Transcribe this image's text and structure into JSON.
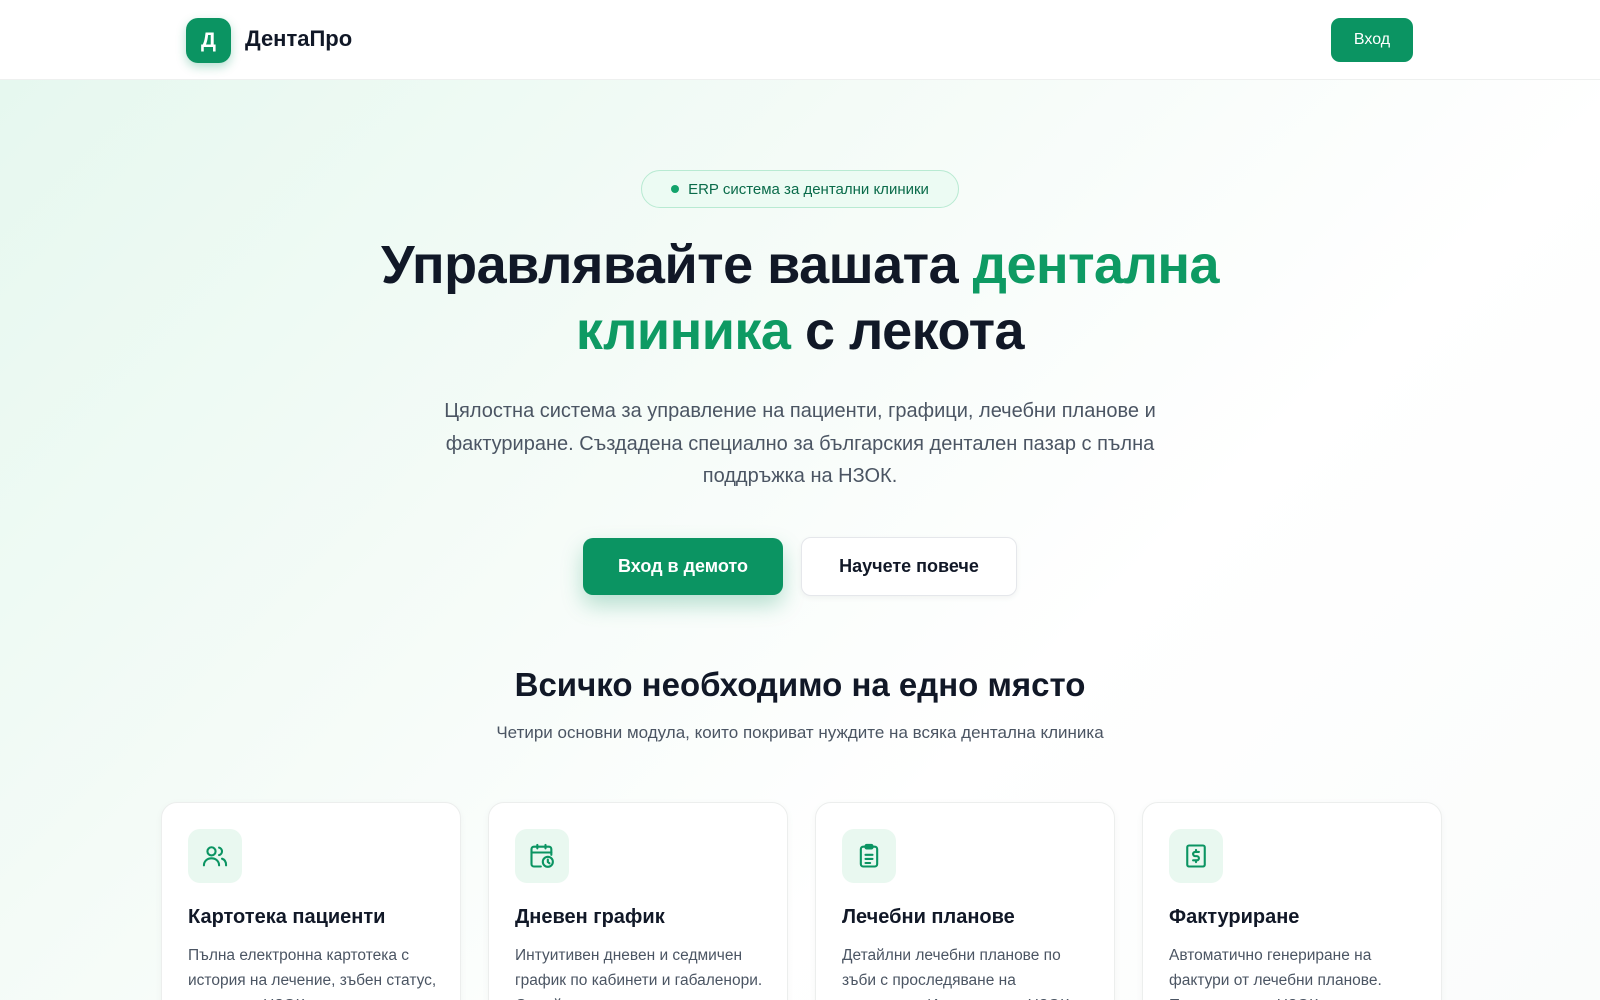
{
  "header": {
    "logo_letter": "Д",
    "brand": "ДентаПро",
    "login_label": "Вход"
  },
  "hero": {
    "badge": "ERP система за дентални клиники",
    "title_part1": "Управлявайте вашата ",
    "title_highlight": "дентална клиника",
    "title_part2": " с лекота",
    "subtitle": "Цялостна система за управление на пациенти, графици, лечебни планове и фактуриране. Създадена специално за българския дентален пазар с пълна поддръжка на НЗОК.",
    "primary_cta": "Вход в демото",
    "secondary_cta": "Научете повече"
  },
  "features": {
    "title": "Всичко необходимо на едно място",
    "subtitle": "Четири основни модула, които покриват нуждите на всяка дентална клиника",
    "cards": [
      {
        "icon": "users-icon",
        "title": "Картотека пациенти",
        "description": "Пълна електронна картотека с история на лечение, зъбен статус, алергии и НЗОК данни."
      },
      {
        "icon": "calendar-clock-icon",
        "title": "Дневен график",
        "description": "Интуитивен дневен и седмичен график по кабинети и габаленори. Онлайн записване."
      },
      {
        "icon": "clipboard-list-icon",
        "title": "Лечебни планове",
        "description": "Детайлни лечебни планове по зъби с проследяване на напредъка. Интеграция с НЗОК."
      },
      {
        "icon": "receipt-dollar-icon",
        "title": "Фактуриране",
        "description": "Автоматично генериране на фактури от лечебни планове. Поддръжка на НЗОК каса."
      }
    ]
  },
  "colors": {
    "accent": "#0b9462",
    "accent_text": "#0e9a63",
    "badge_bg": "#ecfbf3",
    "icon_bg": "#e9f8f0",
    "text_primary": "#111827",
    "text_secondary": "#4b5563"
  }
}
